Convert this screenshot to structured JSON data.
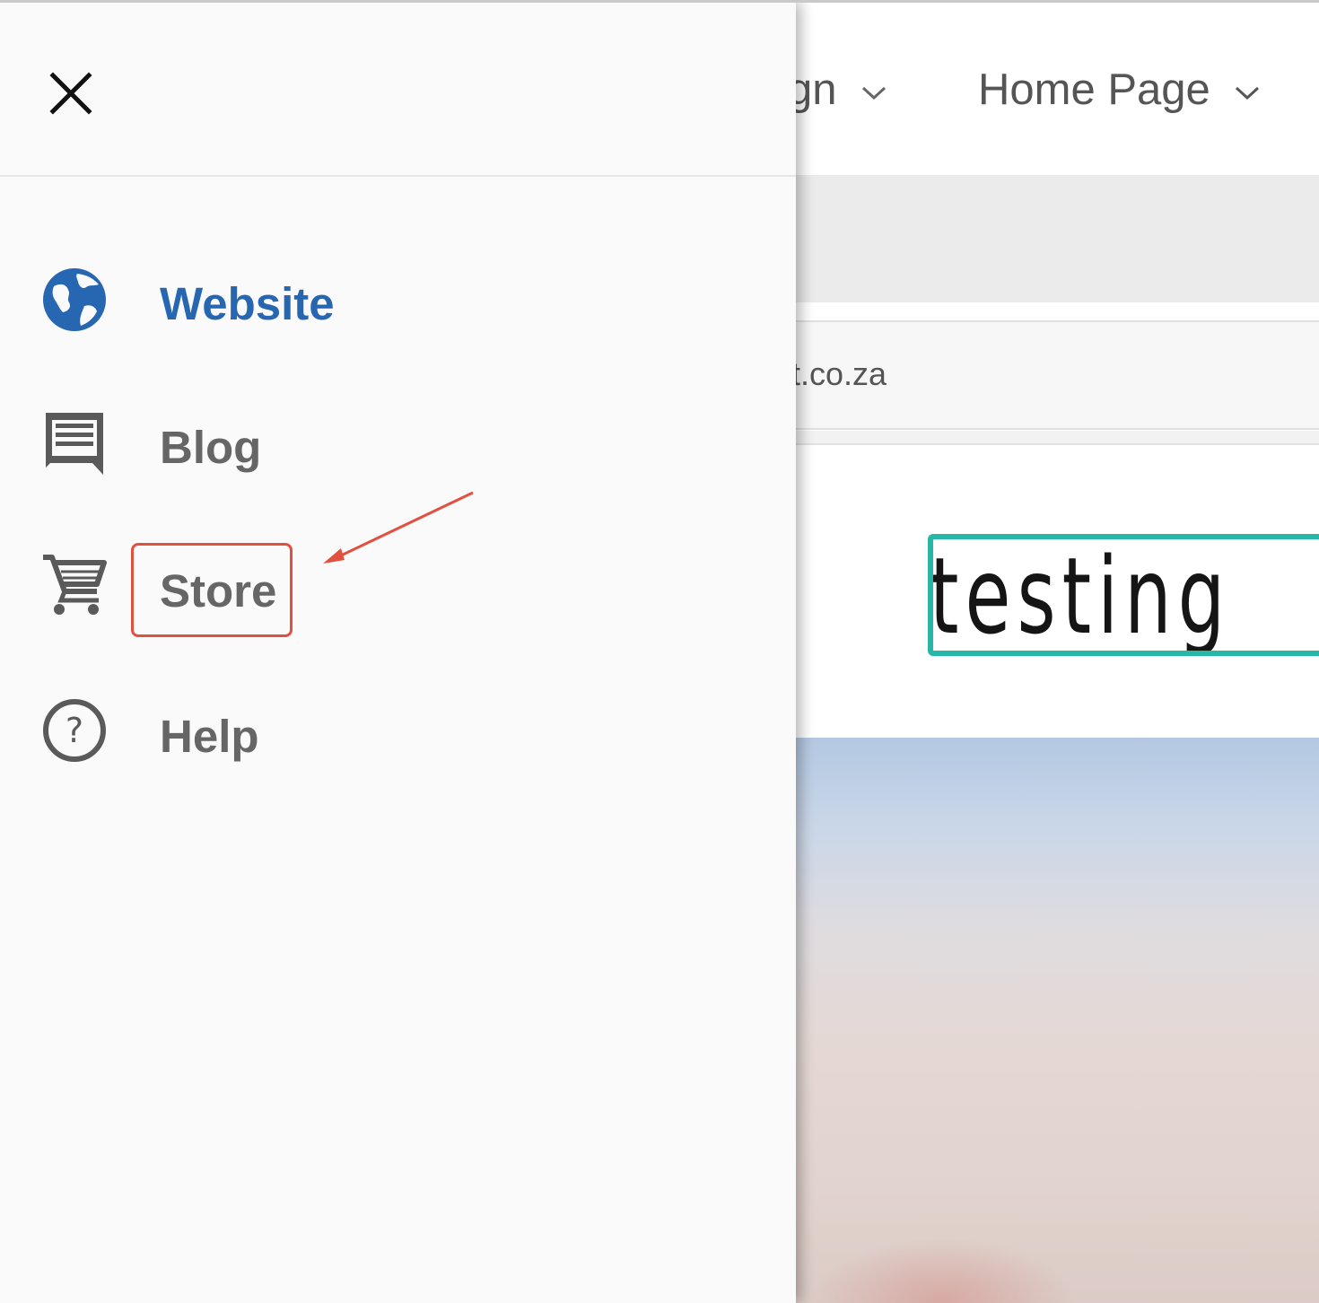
{
  "drawer": {
    "close_icon": "close-icon",
    "items": [
      {
        "label": "Website",
        "icon": "globe-icon",
        "active": true,
        "color": "#2766b0"
      },
      {
        "label": "Blog",
        "icon": "comment-icon",
        "active": false
      },
      {
        "label": "Store",
        "icon": "shopping-cart-icon",
        "active": false,
        "highlighted": true
      },
      {
        "label": "Help",
        "icon": "help-circle-icon",
        "active": false
      }
    ]
  },
  "editor": {
    "menus": [
      {
        "label": "gn",
        "icon": "chevron-down-icon"
      },
      {
        "label": "Home Page",
        "icon": "chevron-down-icon"
      }
    ],
    "url_text": "nt.co.za",
    "logo_text": "testing",
    "logo_border_color": "#27b7a6"
  },
  "annotation": {
    "color": "#e0513f",
    "target": "Store"
  }
}
